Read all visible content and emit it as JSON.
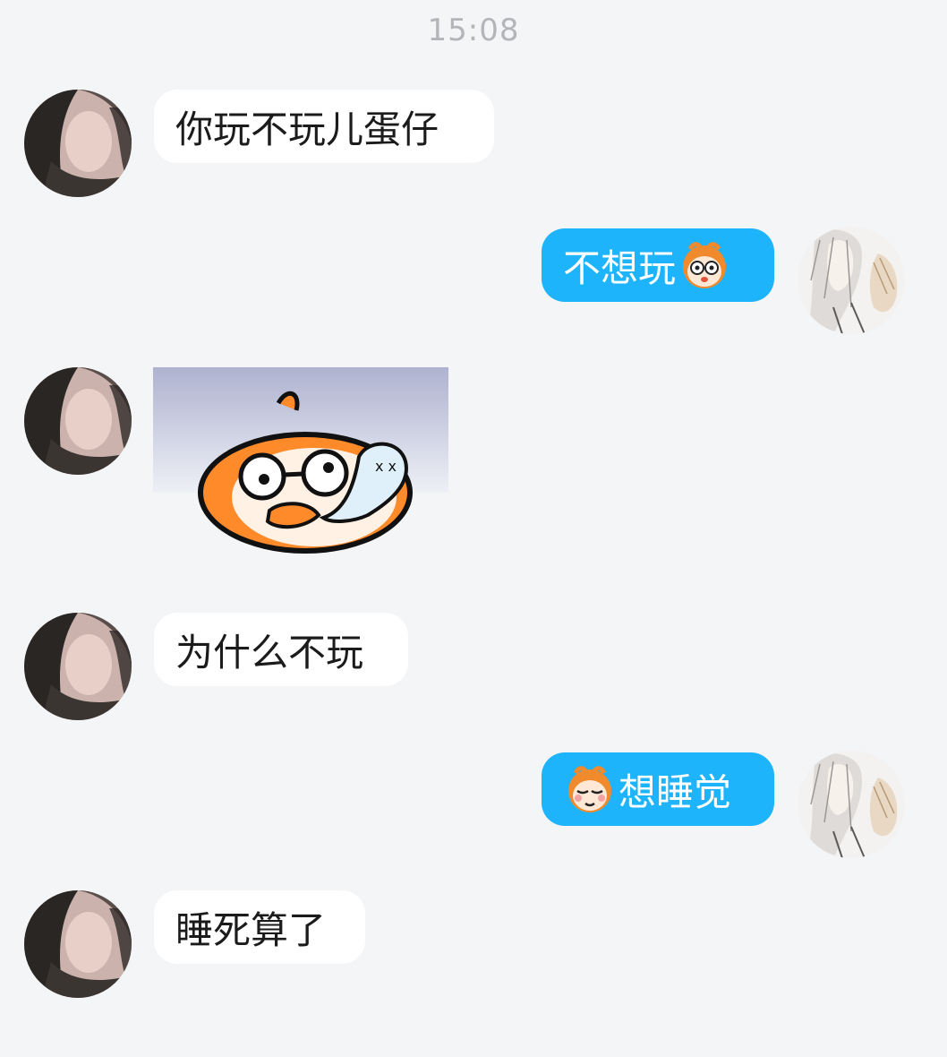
{
  "chat": {
    "timestamp": "15:08",
    "messages": [
      {
        "side": "left",
        "type": "text",
        "text": "你玩不玩儿蛋仔"
      },
      {
        "side": "right",
        "type": "text",
        "text": "不想玩",
        "emoji_after": "monkey-glasses-emoji"
      },
      {
        "side": "left",
        "type": "sticker",
        "sticker": "eggy-party-dizzy-sticker"
      },
      {
        "side": "left",
        "type": "text",
        "text": "为什么不玩"
      },
      {
        "side": "right",
        "type": "text",
        "text": "想睡觉",
        "emoji_before": "monkey-sleepy-emoji"
      },
      {
        "side": "left",
        "type": "text",
        "text": "睡死算了"
      }
    ]
  },
  "colors": {
    "background": "#f4f5f7",
    "incoming_bubble": "#ffffff",
    "outgoing_bubble": "#1eb4fb",
    "timestamp_text": "#b3b5b9"
  }
}
